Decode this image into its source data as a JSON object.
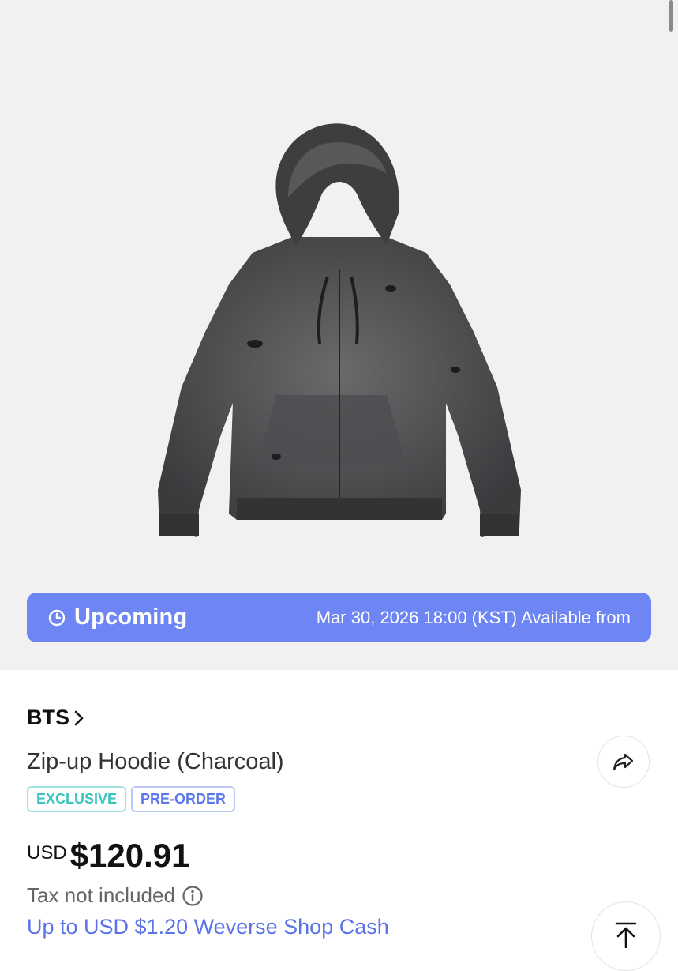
{
  "product": {
    "image_alt": "Zip-up Hoodie (Charcoal) product image",
    "artist": "BTS",
    "title": "Zip-up Hoodie (Charcoal)",
    "badges": [
      "EXCLUSIVE",
      "PRE-ORDER"
    ],
    "currency": "USD",
    "price": "$120.91",
    "tax_note": "Tax not included",
    "cash_note": "Up to USD $1.20 Weverse Shop Cash"
  },
  "banner": {
    "status": "Upcoming",
    "availability": "Mar 30, 2026 18:00 (KST) Available from"
  },
  "icons": {
    "clock": "clock-icon",
    "chevron": "chevron-right-icon",
    "share": "share-icon",
    "info": "info-icon",
    "scroll_top": "scroll-to-top-icon"
  },
  "colors": {
    "banner_bg": "#6d86f3",
    "exclusive": "#3cc4be",
    "preorder": "#5c77ec",
    "cash_link": "#5a73e8"
  }
}
